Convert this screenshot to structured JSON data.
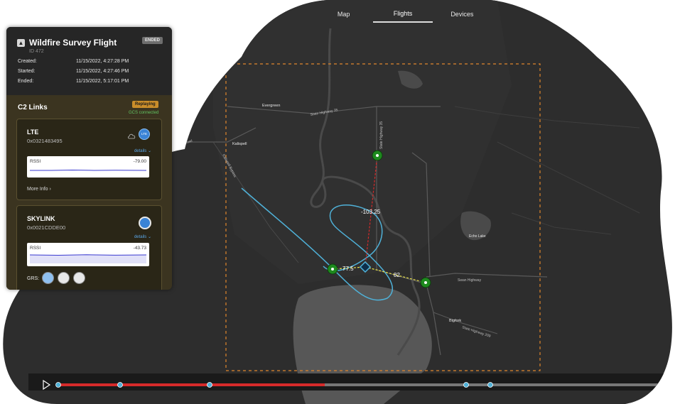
{
  "nav": {
    "tabs": [
      {
        "label": "Map"
      },
      {
        "label": "Flights"
      },
      {
        "label": "Devices"
      }
    ],
    "active": "Flights"
  },
  "flight": {
    "title": "Wildfire Survey Flight",
    "id": "ID 472",
    "status": "ENDED",
    "created_label": "Created:",
    "created": "11/15/2022, 4:27:28 PM",
    "started_label": "Started:",
    "started": "11/15/2022, 4:27:46 PM",
    "ended_label": "Ended:",
    "ended": "11/15/2022, 5:17:01 PM"
  },
  "c2": {
    "title": "C2 Links",
    "replay_badge": "Replaying",
    "gcs_status": "GCS connected",
    "links": [
      {
        "name": "LTE",
        "id": "0x0321483495",
        "details": "details",
        "rssi_label": "RSSI",
        "rssi_value": "-79.00",
        "more": "More Info",
        "badge_text": "LTE"
      },
      {
        "name": "SKYLINK",
        "id": "0x0021CDDE00",
        "details": "details",
        "rssi_label": "RSSI",
        "rssi_value": "-43.73"
      }
    ],
    "grs_label": "GRS:"
  },
  "map": {
    "places": [
      "Evergreen",
      "Kalispell",
      "Bigfork",
      "Echo Lake"
    ],
    "roads": [
      "State Highway 35",
      "Swan Highway",
      "State Highway 209",
      "Kalispell Bypass",
      "Whitefish Stage Road"
    ],
    "range_labels": [
      "-103.25",
      "77.5",
      "82"
    ]
  },
  "colors": {
    "panel_bg": "#1e1e1e",
    "c2_bg": "#3b3420",
    "accent_blue": "#5aa7e8",
    "track": "#4fb1d8",
    "replay_orange": "#c98d2a",
    "timeline_red": "#d62a2a",
    "geofence": "#e0862c"
  },
  "timeline": {
    "progress": 0.43
  }
}
